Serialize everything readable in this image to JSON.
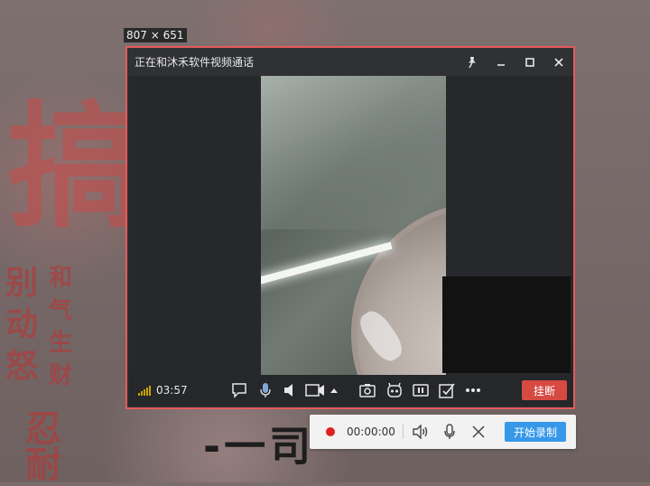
{
  "size_label": "807 × 651",
  "wallpaper": {
    "big_char": "搞",
    "col1": "别动怒",
    "col2": "和气生财",
    "bottom": "忍耐",
    "stroke_text": "-一司"
  },
  "window": {
    "title": "正在和沐禾软件视频通话",
    "buttons": [
      "pin-icon",
      "minimize-icon",
      "maximize-icon",
      "close-icon"
    ]
  },
  "call": {
    "duration": "03:57",
    "hangup_label": "挂断",
    "controls": [
      "chat-icon",
      "microphone-icon",
      "speaker-icon",
      "camera-icon",
      "dropdown-arrow-icon",
      "screenshot-icon",
      "robot-icon",
      "pause-icon",
      "checkbox-icon",
      "more-icon"
    ]
  },
  "recorder": {
    "time": "00:00:00",
    "start_label": "开始录制"
  },
  "colors": {
    "accent_red": "#d64a42",
    "border_red": "#e65a5a",
    "accent_blue": "#3598e8",
    "signal": "#c9a200"
  }
}
